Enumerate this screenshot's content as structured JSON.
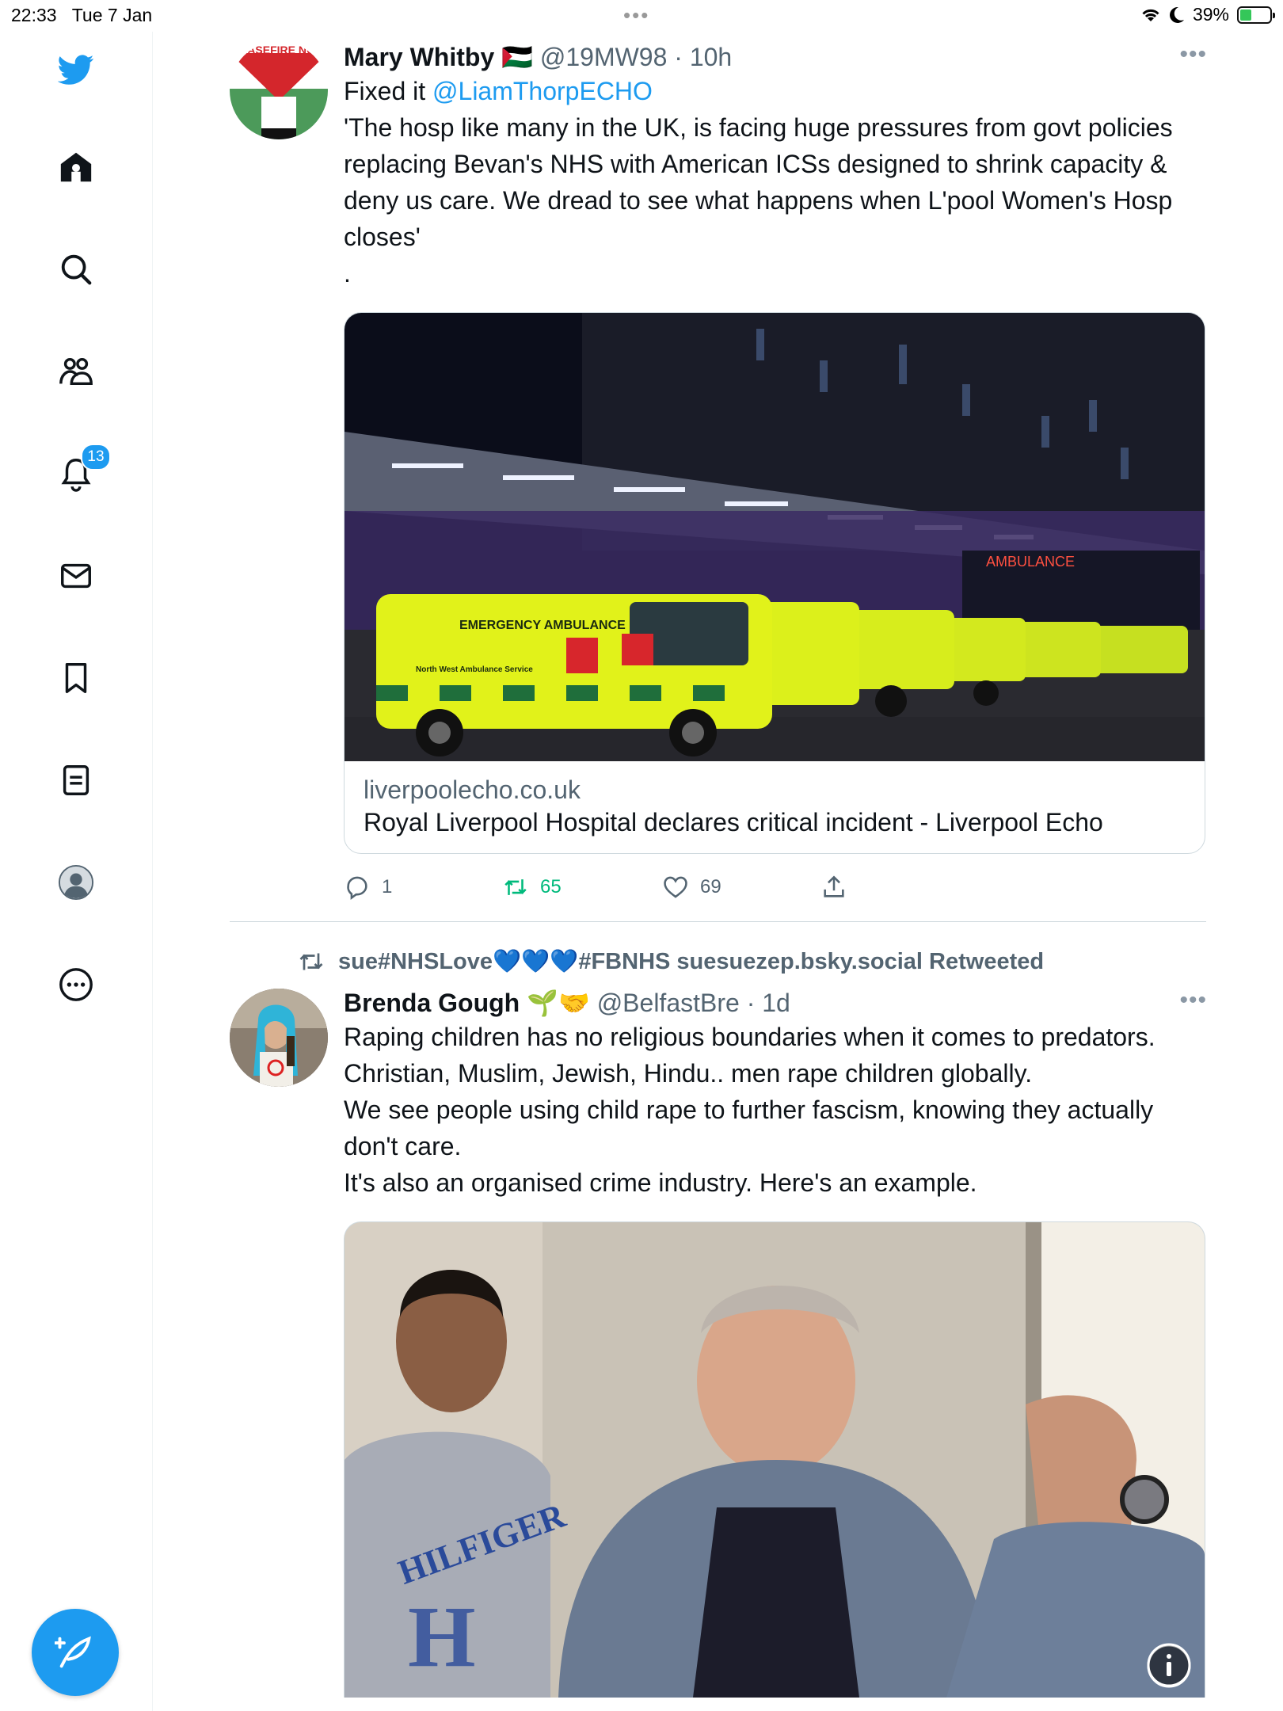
{
  "status_bar": {
    "time": "22:33",
    "date": "Tue 7 Jan",
    "battery": "39%",
    "battery_level": 0.39
  },
  "nav": {
    "notifications_count": "13",
    "items": [
      "twitter-logo",
      "home",
      "search",
      "communities",
      "notifications",
      "messages",
      "bookmarks",
      "lists",
      "profile",
      "more"
    ]
  },
  "tweets": [
    {
      "name": "Mary Whitby",
      "flag": "🇵🇸",
      "handle": "@19MW98",
      "time": "· 10h",
      "text_prefix": "Fixed it ",
      "mention": "@LiamThorpECHO",
      "text": "'The hosp like many in the UK, is facing huge pressures from govt policies replacing Bevan's NHS with American ICSs designed to shrink capacity & deny us care. We dread to see what happens when L'pool Women's Hosp closes'\n.",
      "avatar_text": "CEASEFIRE NOW",
      "card": {
        "domain": "liverpoolecho.co.uk",
        "title": "Royal Liverpool Hospital declares critical incident - Liverpool Echo",
        "image_text": [
          "EMERGENCY AMBULANCE",
          "North West Ambulance Service",
          "AMBULANCE"
        ]
      },
      "actions": {
        "replies": "1",
        "retweets": "65",
        "likes": "69"
      },
      "more": "•••"
    },
    {
      "retweeted_by": "sue#NHSLove💙💙💙#FBNHS suesuezep.bsky.social Retweeted",
      "name": "Brenda Gough",
      "emoji": "🌱🤝",
      "handle": "@BelfastBre",
      "time": "· 1d",
      "text": "Raping children has no religious boundaries when it comes to predators. Christian, Muslim, Jewish, Hindu.. men rape children globally.\nWe see people using child rape to further fascism, knowing they actually don't care.\nIt's also an organised crime industry. Here's an example.",
      "image_text": "HILFIGER",
      "more": "•••"
    }
  ],
  "colors": {
    "accent": "#1d9bf0",
    "retweet": "#00ba7c",
    "text": "#0f1419",
    "secondary": "#536471"
  }
}
